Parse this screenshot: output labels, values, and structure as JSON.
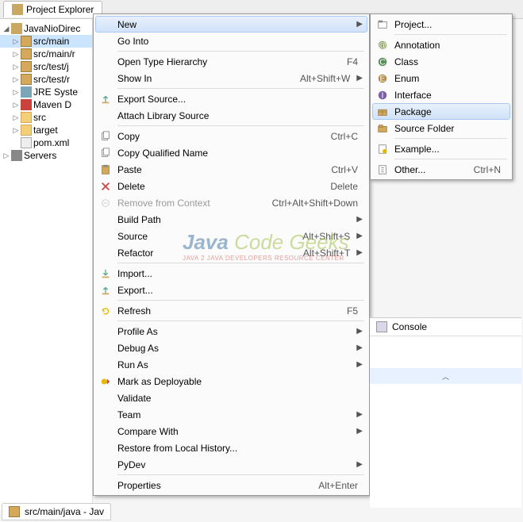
{
  "tab_title": "Project Explorer",
  "tree": {
    "project": "JavaNioDirec",
    "items": [
      {
        "label": "src/main",
        "kind": "pkg",
        "tw": "▷",
        "sel": true
      },
      {
        "label": "src/main/r",
        "kind": "pkg",
        "tw": "▷"
      },
      {
        "label": "src/test/j",
        "kind": "pkg",
        "tw": "▷"
      },
      {
        "label": "src/test/r",
        "kind": "pkg",
        "tw": "▷"
      },
      {
        "label": "JRE Syste",
        "kind": "jre",
        "tw": "▷"
      },
      {
        "label": "Maven D",
        "kind": "mvn",
        "tw": "▷"
      },
      {
        "label": "src",
        "kind": "fld",
        "tw": "▷"
      },
      {
        "label": "target",
        "kind": "fld",
        "tw": "▷"
      },
      {
        "label": "pom.xml",
        "kind": "xml",
        "tw": ""
      }
    ],
    "servers": "Servers"
  },
  "menu1": [
    {
      "label": "New",
      "sub": true,
      "hl": true
    },
    {
      "label": "Go Into"
    },
    {
      "sep": true
    },
    {
      "label": "Open Type Hierarchy",
      "sc": "F4"
    },
    {
      "label": "Show In",
      "sc": "Alt+Shift+W",
      "sub": true
    },
    {
      "sep": true
    },
    {
      "label": "Export Source...",
      "icon": "export"
    },
    {
      "label": "Attach Library Source"
    },
    {
      "sep": true
    },
    {
      "label": "Copy",
      "sc": "Ctrl+C",
      "icon": "copy"
    },
    {
      "label": "Copy Qualified Name",
      "icon": "copy"
    },
    {
      "label": "Paste",
      "sc": "Ctrl+V",
      "icon": "paste"
    },
    {
      "label": "Delete",
      "sc": "Delete",
      "icon": "delete"
    },
    {
      "label": "Remove from Context",
      "sc": "Ctrl+Alt+Shift+Down",
      "disabled": true,
      "icon": "remove"
    },
    {
      "label": "Build Path",
      "sub": true
    },
    {
      "label": "Source",
      "sc": "Alt+Shift+S",
      "sub": true
    },
    {
      "label": "Refactor",
      "sc": "Alt+Shift+T",
      "sub": true
    },
    {
      "sep": true
    },
    {
      "label": "Import...",
      "icon": "import"
    },
    {
      "label": "Export...",
      "icon": "export"
    },
    {
      "sep": true
    },
    {
      "label": "Refresh",
      "sc": "F5",
      "icon": "refresh"
    },
    {
      "sep": true
    },
    {
      "label": "Profile As",
      "sub": true
    },
    {
      "label": "Debug As",
      "sub": true
    },
    {
      "label": "Run As",
      "sub": true
    },
    {
      "label": "Mark as Deployable",
      "icon": "deploy"
    },
    {
      "label": "Validate"
    },
    {
      "label": "Team",
      "sub": true
    },
    {
      "label": "Compare With",
      "sub": true
    },
    {
      "label": "Restore from Local History..."
    },
    {
      "label": "PyDev",
      "sub": true
    },
    {
      "sep": true
    },
    {
      "label": "Properties",
      "sc": "Alt+Enter"
    }
  ],
  "menu2": [
    {
      "label": "Project...",
      "icon": "project"
    },
    {
      "sep": true
    },
    {
      "label": "Annotation",
      "icon": "annotation"
    },
    {
      "label": "Class",
      "icon": "class"
    },
    {
      "label": "Enum",
      "icon": "enum"
    },
    {
      "label": "Interface",
      "icon": "interface"
    },
    {
      "label": "Package",
      "icon": "package",
      "hl": true
    },
    {
      "label": "Source Folder",
      "icon": "srcfolder"
    },
    {
      "sep": true
    },
    {
      "label": "Example...",
      "icon": "example"
    },
    {
      "sep": true
    },
    {
      "label": "Other...",
      "sc": "Ctrl+N",
      "icon": "other"
    }
  ],
  "console": "Console",
  "bottom_tab": "src/main/java - Jav",
  "watermark": {
    "t1": "Java ",
    "t2": "Code Geeks",
    "sub": "JAVA 2 JAVA DEVELOPERS RESOURCE CENTER"
  }
}
